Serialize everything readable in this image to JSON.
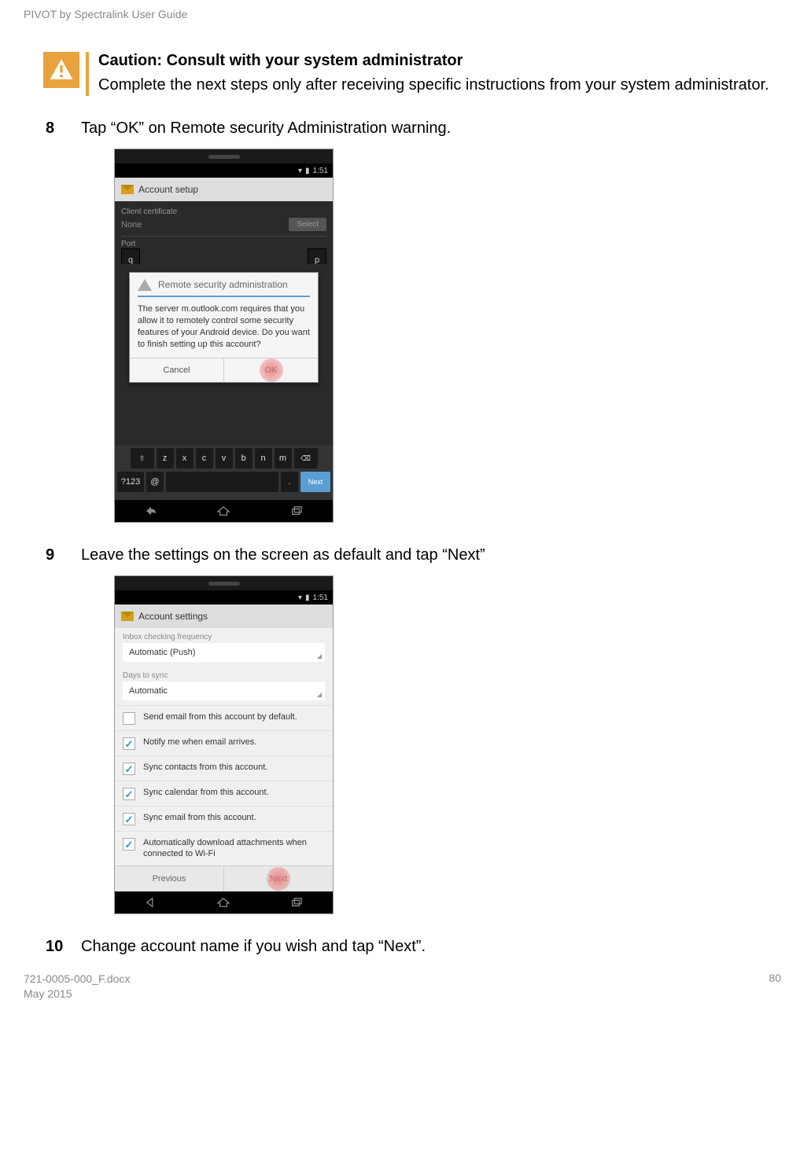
{
  "header": "PIVOT by Spectralink User Guide",
  "caution": {
    "title": "Caution: Consult with your system administrator",
    "body": "Complete the next steps only after receiving specific instructions from your system administrator."
  },
  "steps": {
    "s8": {
      "num": "8",
      "text": "Tap “OK” on Remote security Administration warning."
    },
    "s9": {
      "num": "9",
      "text": "Leave the settings on the screen as default and tap “Next”"
    },
    "s10": {
      "num": "10",
      "text": "Change account name if you wish and tap “Next”."
    }
  },
  "phone1": {
    "time": "1:51",
    "appTitle": "Account setup",
    "clientCertLabel": "Client certificate",
    "clientCertValue": "None",
    "selectBtn": "Select",
    "portLabel": "Port",
    "dialogTitle": "Remote security\nadministration",
    "dialogBody": "The server m.outlook.com requires that you allow it to remotely control some security features of your Android device. Do you want to finish setting up this account?",
    "cancel": "Cancel",
    "ok": "OK",
    "keys_q": "q",
    "keys_p": "p",
    "kbdRow2": [
      "⇧",
      "z",
      "x",
      "c",
      "v",
      "b",
      "n",
      "m",
      "⌫"
    ],
    "kbdRow3_sym": "?123",
    "kbdRow3_at": "@",
    "kbdRow3_dot": ".",
    "kbdRow3_next": "Next"
  },
  "phone2": {
    "time": "1:51",
    "appTitle": "Account settings",
    "inboxFreqLabel": "Inbox checking frequency",
    "inboxFreqValue": "Automatic (Push)",
    "daysSyncLabel": "Days to sync",
    "daysSyncValue": "Automatic",
    "opts": [
      {
        "checked": false,
        "text": "Send email from this account by default."
      },
      {
        "checked": true,
        "text": "Notify me when email arrives."
      },
      {
        "checked": true,
        "text": "Sync contacts from this account."
      },
      {
        "checked": true,
        "text": "Sync calendar from this account."
      },
      {
        "checked": true,
        "text": "Sync email from this account."
      },
      {
        "checked": true,
        "text": "Automatically download attachments when connected to Wi-Fi"
      }
    ],
    "previous": "Previous",
    "next": "Next"
  },
  "footer": {
    "fileLine": "721-0005-000_F.docx",
    "dateLine": "May 2015",
    "pageNum": "80"
  }
}
